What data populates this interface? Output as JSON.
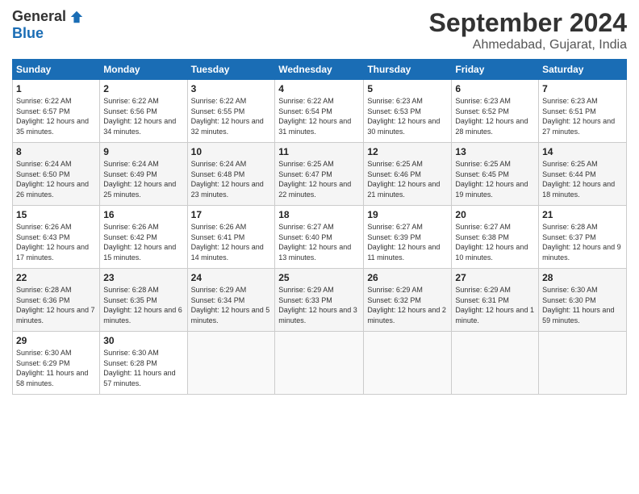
{
  "header": {
    "logo_general": "General",
    "logo_blue": "Blue",
    "month_title": "September 2024",
    "location": "Ahmedabad, Gujarat, India"
  },
  "weekdays": [
    "Sunday",
    "Monday",
    "Tuesday",
    "Wednesday",
    "Thursday",
    "Friday",
    "Saturday"
  ],
  "weeks": [
    [
      {
        "day": "1",
        "sunrise": "6:22 AM",
        "sunset": "6:57 PM",
        "daylight": "12 hours and 35 minutes."
      },
      {
        "day": "2",
        "sunrise": "6:22 AM",
        "sunset": "6:56 PM",
        "daylight": "12 hours and 34 minutes."
      },
      {
        "day": "3",
        "sunrise": "6:22 AM",
        "sunset": "6:55 PM",
        "daylight": "12 hours and 32 minutes."
      },
      {
        "day": "4",
        "sunrise": "6:22 AM",
        "sunset": "6:54 PM",
        "daylight": "12 hours and 31 minutes."
      },
      {
        "day": "5",
        "sunrise": "6:23 AM",
        "sunset": "6:53 PM",
        "daylight": "12 hours and 30 minutes."
      },
      {
        "day": "6",
        "sunrise": "6:23 AM",
        "sunset": "6:52 PM",
        "daylight": "12 hours and 28 minutes."
      },
      {
        "day": "7",
        "sunrise": "6:23 AM",
        "sunset": "6:51 PM",
        "daylight": "12 hours and 27 minutes."
      }
    ],
    [
      {
        "day": "8",
        "sunrise": "6:24 AM",
        "sunset": "6:50 PM",
        "daylight": "12 hours and 26 minutes."
      },
      {
        "day": "9",
        "sunrise": "6:24 AM",
        "sunset": "6:49 PM",
        "daylight": "12 hours and 25 minutes."
      },
      {
        "day": "10",
        "sunrise": "6:24 AM",
        "sunset": "6:48 PM",
        "daylight": "12 hours and 23 minutes."
      },
      {
        "day": "11",
        "sunrise": "6:25 AM",
        "sunset": "6:47 PM",
        "daylight": "12 hours and 22 minutes."
      },
      {
        "day": "12",
        "sunrise": "6:25 AM",
        "sunset": "6:46 PM",
        "daylight": "12 hours and 21 minutes."
      },
      {
        "day": "13",
        "sunrise": "6:25 AM",
        "sunset": "6:45 PM",
        "daylight": "12 hours and 19 minutes."
      },
      {
        "day": "14",
        "sunrise": "6:25 AM",
        "sunset": "6:44 PM",
        "daylight": "12 hours and 18 minutes."
      }
    ],
    [
      {
        "day": "15",
        "sunrise": "6:26 AM",
        "sunset": "6:43 PM",
        "daylight": "12 hours and 17 minutes."
      },
      {
        "day": "16",
        "sunrise": "6:26 AM",
        "sunset": "6:42 PM",
        "daylight": "12 hours and 15 minutes."
      },
      {
        "day": "17",
        "sunrise": "6:26 AM",
        "sunset": "6:41 PM",
        "daylight": "12 hours and 14 minutes."
      },
      {
        "day": "18",
        "sunrise": "6:27 AM",
        "sunset": "6:40 PM",
        "daylight": "12 hours and 13 minutes."
      },
      {
        "day": "19",
        "sunrise": "6:27 AM",
        "sunset": "6:39 PM",
        "daylight": "12 hours and 11 minutes."
      },
      {
        "day": "20",
        "sunrise": "6:27 AM",
        "sunset": "6:38 PM",
        "daylight": "12 hours and 10 minutes."
      },
      {
        "day": "21",
        "sunrise": "6:28 AM",
        "sunset": "6:37 PM",
        "daylight": "12 hours and 9 minutes."
      }
    ],
    [
      {
        "day": "22",
        "sunrise": "6:28 AM",
        "sunset": "6:36 PM",
        "daylight": "12 hours and 7 minutes."
      },
      {
        "day": "23",
        "sunrise": "6:28 AM",
        "sunset": "6:35 PM",
        "daylight": "12 hours and 6 minutes."
      },
      {
        "day": "24",
        "sunrise": "6:29 AM",
        "sunset": "6:34 PM",
        "daylight": "12 hours and 5 minutes."
      },
      {
        "day": "25",
        "sunrise": "6:29 AM",
        "sunset": "6:33 PM",
        "daylight": "12 hours and 3 minutes."
      },
      {
        "day": "26",
        "sunrise": "6:29 AM",
        "sunset": "6:32 PM",
        "daylight": "12 hours and 2 minutes."
      },
      {
        "day": "27",
        "sunrise": "6:29 AM",
        "sunset": "6:31 PM",
        "daylight": "12 hours and 1 minute."
      },
      {
        "day": "28",
        "sunrise": "6:30 AM",
        "sunset": "6:30 PM",
        "daylight": "11 hours and 59 minutes."
      }
    ],
    [
      {
        "day": "29",
        "sunrise": "6:30 AM",
        "sunset": "6:29 PM",
        "daylight": "11 hours and 58 minutes."
      },
      {
        "day": "30",
        "sunrise": "6:30 AM",
        "sunset": "6:28 PM",
        "daylight": "11 hours and 57 minutes."
      },
      {
        "day": "",
        "sunrise": "",
        "sunset": "",
        "daylight": ""
      },
      {
        "day": "",
        "sunrise": "",
        "sunset": "",
        "daylight": ""
      },
      {
        "day": "",
        "sunrise": "",
        "sunset": "",
        "daylight": ""
      },
      {
        "day": "",
        "sunrise": "",
        "sunset": "",
        "daylight": ""
      },
      {
        "day": "",
        "sunrise": "",
        "sunset": "",
        "daylight": ""
      }
    ]
  ],
  "labels": {
    "sunrise": "Sunrise:",
    "sunset": "Sunset:",
    "daylight": "Daylight:"
  }
}
